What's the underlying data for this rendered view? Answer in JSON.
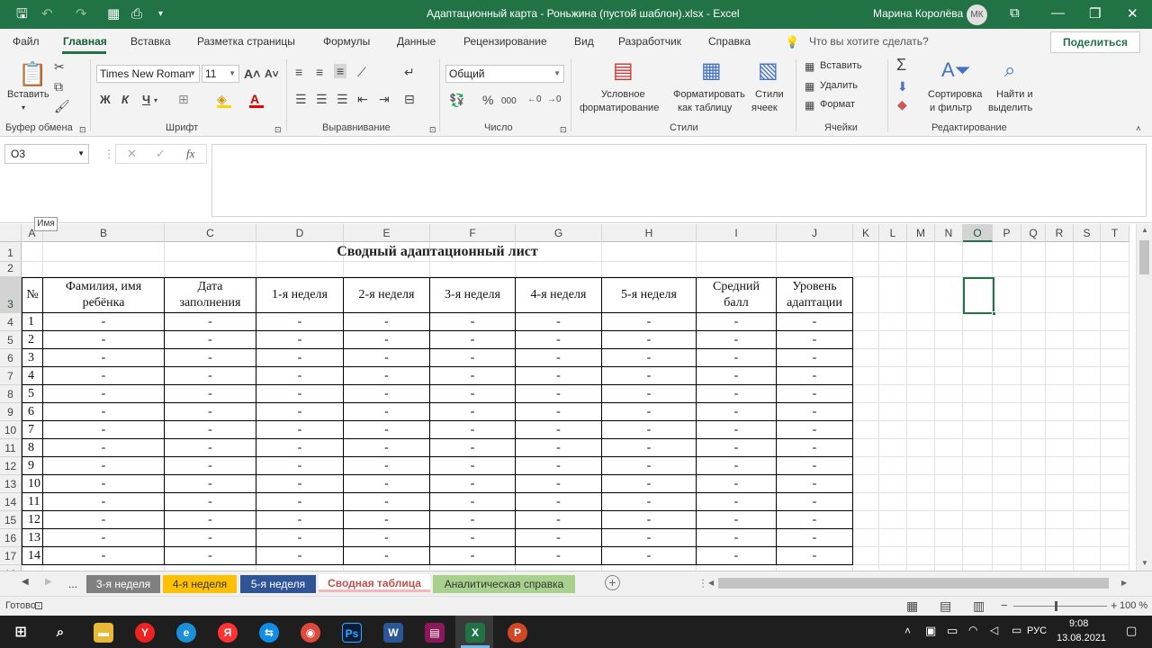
{
  "window": {
    "title": "Адаптационный карта - Роньжина (пустой шаблон).xlsx  -  Excel",
    "user": "Марина Королёва",
    "initials": "МК"
  },
  "menu": {
    "file": "Файл",
    "home": "Главная",
    "insert": "Вставка",
    "layout": "Разметка страницы",
    "formulas": "Формулы",
    "data": "Данные",
    "review": "Рецензирование",
    "view": "Вид",
    "developer": "Разработчик",
    "help": "Справка",
    "tellme": "Что вы хотите сделать?",
    "share": "Поделиться"
  },
  "ribbon": {
    "paste": "Вставить",
    "clipboard": "Буфер обмена",
    "font_name": "Times New Roman",
    "font_size": "11",
    "bold": "Ж",
    "italic": "К",
    "underline": "Ч",
    "font_group": "Шрифт",
    "align_group": "Выравнивание",
    "number_format": "Общий",
    "number_group": "Число",
    "cond_fmt_1": "Условное",
    "cond_fmt_2": "форматирование",
    "fmt_table_1": "Форматировать",
    "fmt_table_2": "как таблицу",
    "styles_1": "Стили",
    "styles_2": "ячеек",
    "styles_group": "Стили",
    "insert": "Вставить",
    "delete": "Удалить",
    "format": "Формат",
    "cells_group": "Ячейки",
    "sort_1": "Сортировка",
    "sort_2": "и фильтр",
    "find_1": "Найти и",
    "find_2": "выделить",
    "editing_group": "Редактирование"
  },
  "formula": {
    "namebox": "O3",
    "fx": "fx",
    "tooltip": "Имя"
  },
  "columns": [
    "A",
    "B",
    "C",
    "D",
    "E",
    "F",
    "G",
    "H",
    "I",
    "J",
    "K",
    "L",
    "M",
    "N",
    "O",
    "P",
    "Q",
    "R",
    "S",
    "T"
  ],
  "sheet": {
    "title": "Сводный адаптационный лист",
    "headers": {
      "num": "№",
      "name_1": "Фамилия, имя",
      "name_2": "ребёнка",
      "date_1": "Дата",
      "date_2": "заполнения",
      "w1": "1-я неделя",
      "w2": "2-я неделя",
      "w3": "3-я неделя",
      "w4": "4-я неделя",
      "w5": "5-я неделя",
      "avg_1": "Средний",
      "avg_2": "балл",
      "lvl_1": "Уровень",
      "lvl_2": "адаптации"
    },
    "row_numbers": [
      "1",
      "2",
      "3",
      "4",
      "5",
      "6",
      "7",
      "8",
      "9",
      "10",
      "11",
      "12",
      "13",
      "14",
      "15"
    ],
    "data_rows": [
      [
        "1",
        "-",
        "-",
        "-",
        "-",
        "-",
        "-",
        "-",
        "-",
        "-"
      ],
      [
        "2",
        "-",
        "-",
        "-",
        "-",
        "-",
        "-",
        "-",
        "-",
        "-"
      ],
      [
        "3",
        "-",
        "-",
        "-",
        "-",
        "-",
        "-",
        "-",
        "-",
        "-"
      ],
      [
        "4",
        "-",
        "-",
        "-",
        "-",
        "-",
        "-",
        "-",
        "-",
        "-"
      ],
      [
        "5",
        "-",
        "-",
        "-",
        "-",
        "-",
        "-",
        "-",
        "-",
        "-"
      ],
      [
        "6",
        "-",
        "-",
        "-",
        "-",
        "-",
        "-",
        "-",
        "-",
        "-"
      ],
      [
        "7",
        "-",
        "-",
        "-",
        "-",
        "-",
        "-",
        "-",
        "-",
        "-"
      ],
      [
        "8",
        "-",
        "-",
        "-",
        "-",
        "-",
        "-",
        "-",
        "-",
        "-"
      ],
      [
        "9",
        "-",
        "-",
        "-",
        "-",
        "-",
        "-",
        "-",
        "-",
        "-"
      ],
      [
        "10",
        "-",
        "-",
        "-",
        "-",
        "-",
        "-",
        "-",
        "-",
        "-"
      ],
      [
        "11",
        "-",
        "-",
        "-",
        "-",
        "-",
        "-",
        "-",
        "-",
        "-"
      ],
      [
        "12",
        "-",
        "-",
        "-",
        "-",
        "-",
        "-",
        "-",
        "-",
        "-"
      ],
      [
        "13",
        "-",
        "-",
        "-",
        "-",
        "-",
        "-",
        "-",
        "-",
        "-"
      ],
      [
        "14",
        "-",
        "-",
        "-",
        "-",
        "-",
        "-",
        "-",
        "-",
        "-"
      ]
    ]
  },
  "tabs": {
    "more": "...",
    "t1": "3-я неделя",
    "t2": "4-я неделя",
    "t3": "5-я неделя",
    "t4": "Сводная таблица",
    "t5": "Аналитическая справка",
    "add": "+"
  },
  "status": {
    "ready": "Готово",
    "zoom": "100 %"
  },
  "taskbar": {
    "lang": "РУС",
    "time": "9:08",
    "date": "13.08.2021"
  }
}
